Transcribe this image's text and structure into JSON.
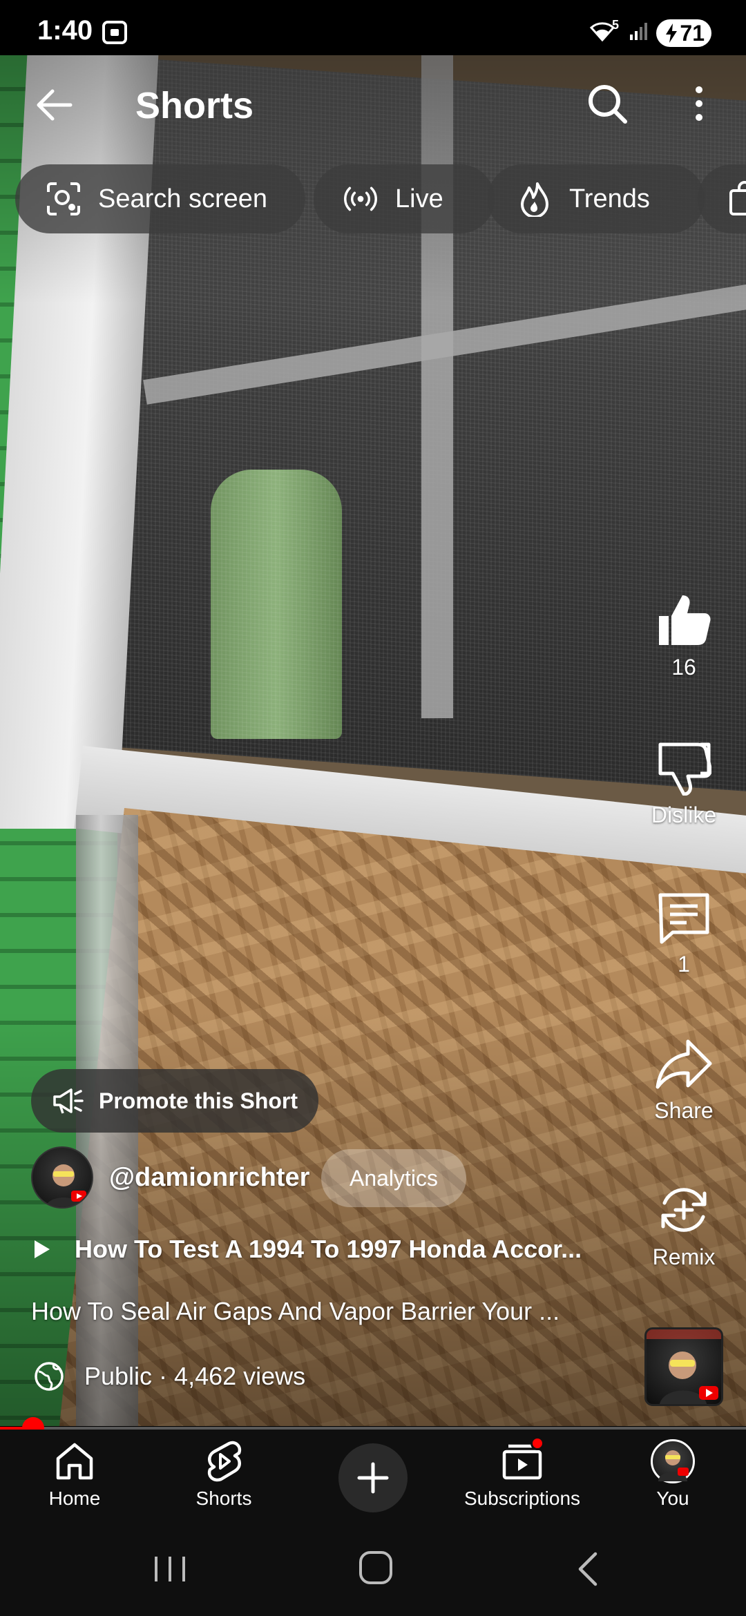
{
  "status_bar": {
    "time": "1:40",
    "wifi_label": "5",
    "battery": "71"
  },
  "header": {
    "title": "Shorts"
  },
  "chips": [
    {
      "label": "Search screen",
      "icon": "search-screen-icon"
    },
    {
      "label": "Live",
      "icon": "live-icon"
    },
    {
      "label": "Trends",
      "icon": "trends-icon"
    },
    {
      "label": "",
      "icon": "shopping-bag-icon"
    }
  ],
  "actions": {
    "like_count": "16",
    "dislike_label": "Dislike",
    "comment_count": "1",
    "share_label": "Share",
    "remix_label": "Remix"
  },
  "overlay": {
    "promote_label": "Promote this Short",
    "channel_handle": "@damionrichter",
    "analytics_label": "Analytics",
    "related_video": "How To Test A 1994 To 1997 Honda Accor...",
    "title": "How To Seal Air Gaps And Vapor Barrier Your  ...",
    "visibility": "Public · 4,462 views"
  },
  "progress": {
    "fraction": 0.044
  },
  "bottom_nav": [
    {
      "label": "Home",
      "icon": "home-icon"
    },
    {
      "label": "Shorts",
      "icon": "shorts-icon"
    },
    {
      "label": "",
      "icon": "create-icon"
    },
    {
      "label": "Subscriptions",
      "icon": "subscriptions-icon"
    },
    {
      "label": "You",
      "icon": "avatar"
    }
  ],
  "colors": {
    "accent": "#ff0000",
    "nav_background": "#0f0f0f"
  }
}
